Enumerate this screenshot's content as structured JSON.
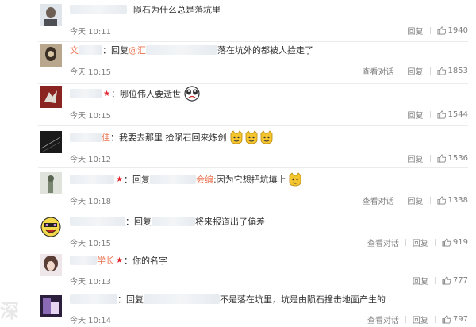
{
  "comments": [
    {
      "text": "陨石为什么总是落坑里",
      "time": "今天 10:11",
      "reply_label": "回复",
      "likes": "1940"
    },
    {
      "user_prefix": "文",
      "reply_prefix": "：回复",
      "mention": "@汇",
      "text": "落在坑外的都被人捡走了",
      "time": "今天 10:15",
      "view_label": "查看对话",
      "reply_label": "回复",
      "likes": "1853"
    },
    {
      "text": "：哪位伟人要逝世",
      "time": "今天 10:15",
      "reply_label": "回复",
      "likes": "1544"
    },
    {
      "user_suffix": "佳",
      "text": "：我要去那里 捡陨石回来炼剑",
      "time": "今天 10:12",
      "reply_label": "回复",
      "likes": "1536"
    },
    {
      "reply_prefix": "：回复",
      "mention_tail": "会编",
      "text": ":因为它想把坑填上",
      "time": "今天 10:18",
      "view_label": "查看对话",
      "reply_label": "回复",
      "likes": "1338"
    },
    {
      "reply_prefix": "：回复",
      "text": "将来报道出了偏差",
      "time": "今天 10:15",
      "view_label": "查看对话",
      "reply_label": "回复",
      "likes": "919"
    },
    {
      "user_tail": "学长",
      "text": "：你的名字",
      "time": "今天 10:13",
      "reply_label": "回复",
      "likes": "777"
    },
    {
      "reply_prefix": "：回复",
      "text": "不是落在坑里，坑是由陨石撞击地面产生的",
      "time": "今天 10:14",
      "view_label": "查看对话",
      "reply_label": "回复",
      "likes": "797"
    }
  ],
  "watermark": "深"
}
